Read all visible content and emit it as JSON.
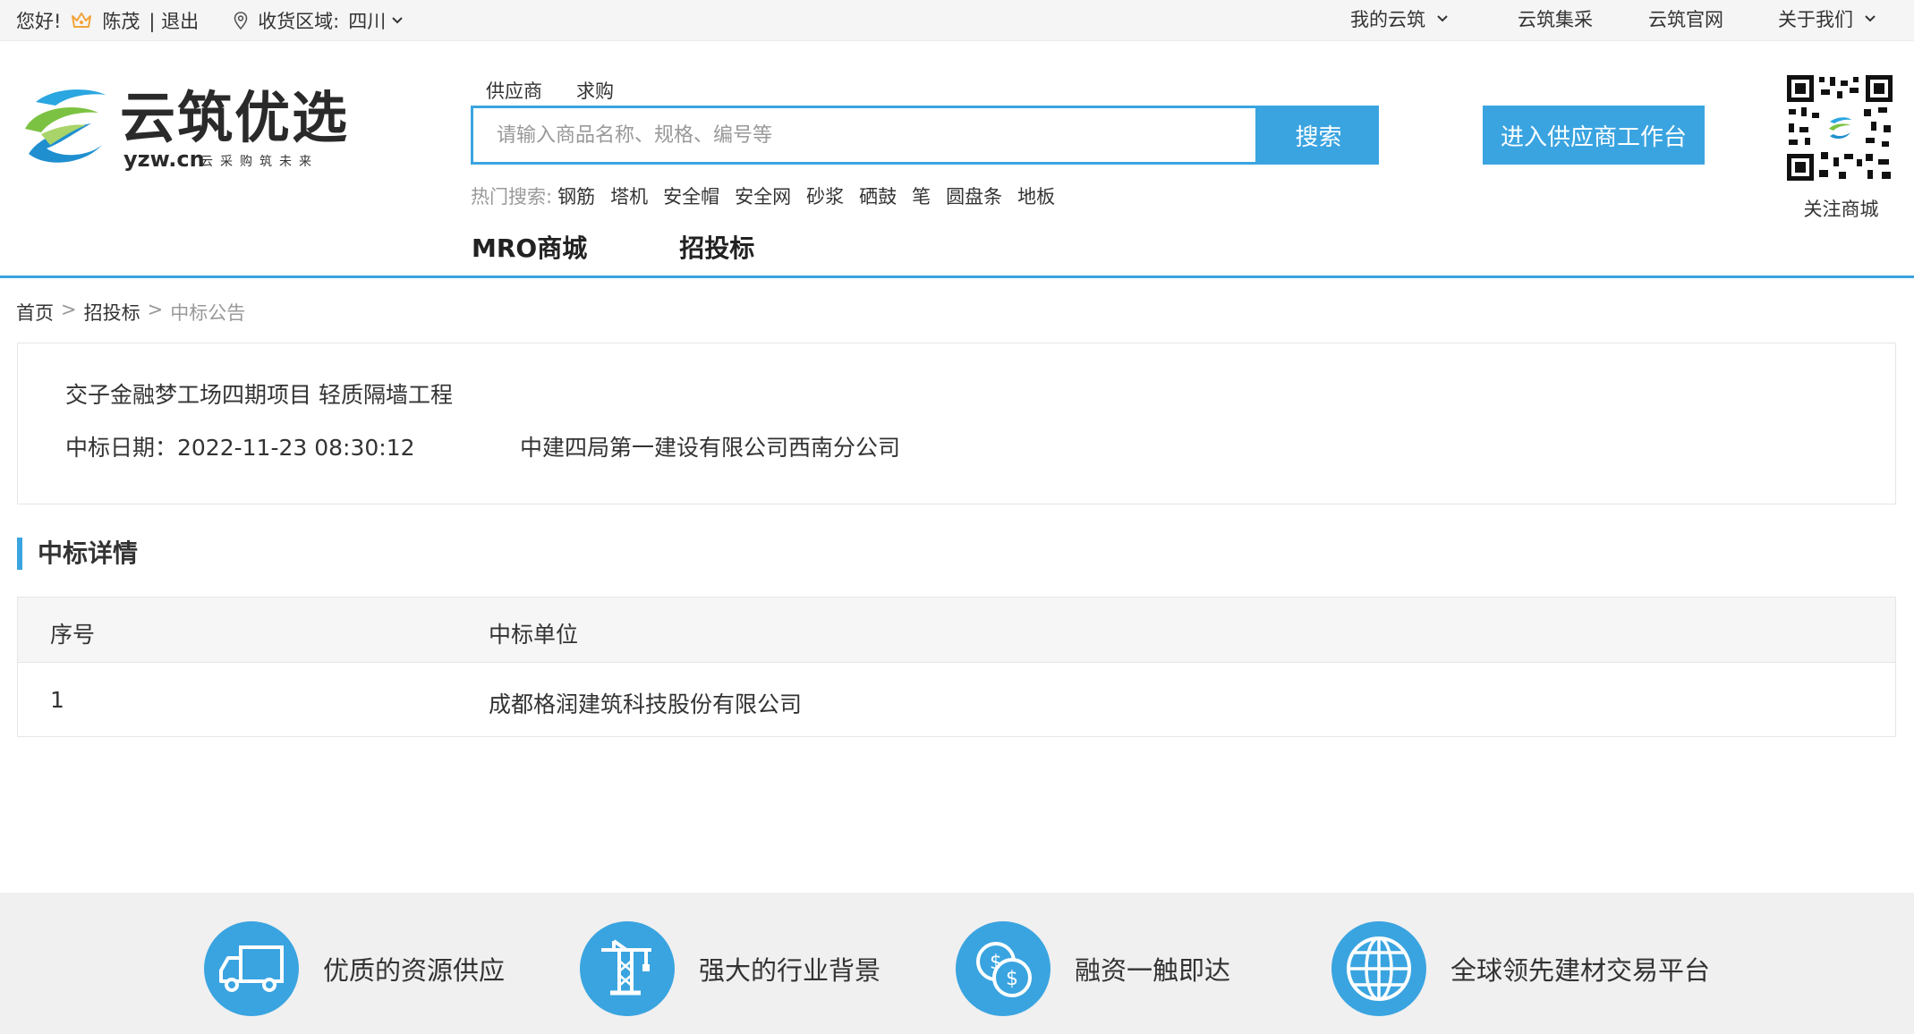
{
  "topbar": {
    "greeting": "您好!",
    "username": "陈茂",
    "logout": "| 退出",
    "region_label": "收货区域:",
    "region_value": "四川",
    "links": [
      {
        "label": "我的云筑",
        "has_dropdown": true
      },
      {
        "label": "云筑集采",
        "has_dropdown": false
      },
      {
        "label": "云筑官网",
        "has_dropdown": false
      },
      {
        "label": "关于我们",
        "has_dropdown": true
      }
    ]
  },
  "logo": {
    "name": "云筑优选",
    "domain": "yzw.cn",
    "slogan": "云采购筑未来"
  },
  "search": {
    "tabs": [
      "供应商",
      "求购"
    ],
    "placeholder": "请输入商品名称、规格、编号等",
    "button": "搜索",
    "hot_label": "热门搜索:",
    "hot_items": [
      "钢筋",
      "塔机",
      "安全帽",
      "安全网",
      "砂浆",
      "硒鼓",
      "笔",
      "圆盘条",
      "地板"
    ]
  },
  "supplier_button": "进入供应商工作台",
  "qr_label": "关注商城",
  "main_nav": [
    "MRO商城",
    "招投标"
  ],
  "breadcrumb": [
    "首页",
    "招投标",
    "中标公告"
  ],
  "project": {
    "title": "交子金融梦工场四期项目 轻质隔墙工程",
    "date": "中标日期：2022-11-23 08:30:12",
    "company": "中建四局第一建设有限公司西南分公司"
  },
  "detail": {
    "title": "中标详情",
    "columns": [
      "序号",
      "中标单位"
    ],
    "rows": [
      {
        "no": "1",
        "winner": "成都格润建筑科技股份有限公司"
      }
    ]
  },
  "footer": {
    "features": [
      {
        "icon": "truck-icon",
        "label": "优质的资源供应"
      },
      {
        "icon": "tower-crane-icon",
        "label": "强大的行业背景"
      },
      {
        "icon": "coins-icon",
        "label": "融资一触即达"
      },
      {
        "icon": "globe-icon",
        "label": "全球领先建材交易平台"
      }
    ]
  },
  "colors": {
    "accent": "#3aa4e0",
    "crown": "#f2a43a",
    "footer_bg": "#f0f0f0"
  }
}
